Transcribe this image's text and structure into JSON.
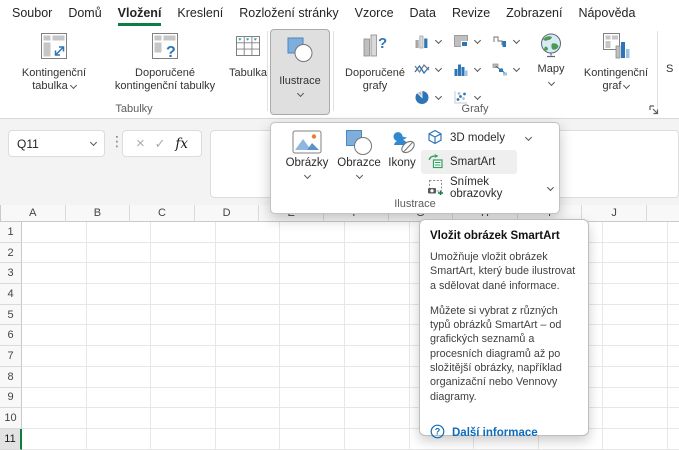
{
  "menu": {
    "tabs": [
      {
        "label": "Soubor"
      },
      {
        "label": "Domů"
      },
      {
        "label": "Vložení"
      },
      {
        "label": "Kreslení"
      },
      {
        "label": "Rozložení stránky"
      },
      {
        "label": "Vzorce"
      },
      {
        "label": "Data"
      },
      {
        "label": "Revize"
      },
      {
        "label": "Zobrazení"
      },
      {
        "label": "Nápověda"
      }
    ],
    "active_tab": "Vložení"
  },
  "ribbon": {
    "pivot_table": {
      "line1": "Kontingenční",
      "line2": "tabulka"
    },
    "recommended_pivots": {
      "line1": "Doporučené",
      "line2": "kontingenční tabulky"
    },
    "table": {
      "label": "Tabulka"
    },
    "illustrations": {
      "label": "Ilustrace"
    },
    "recommended_charts": {
      "line1": "Doporučené",
      "line2": "grafy"
    },
    "maps": {
      "label": "Mapy"
    },
    "pivot_chart": {
      "line1": "Kontingenční",
      "line2": "graf"
    },
    "group_tables": "Tabulky",
    "group_charts": "Grafy",
    "cutoff_right": "S"
  },
  "formula_bar": {
    "name_box_value": "Q11"
  },
  "icons": {
    "cancel": "×",
    "enter": "✓",
    "fx": "fx",
    "dots": "⋮"
  },
  "dropdown": {
    "items_large": [
      {
        "label": "Obrázky",
        "has_chevron": true
      },
      {
        "label": "Obrazce",
        "has_chevron": true
      },
      {
        "label": "Ikony",
        "has_chevron": false
      }
    ],
    "items_menu": [
      {
        "label": "3D modely",
        "has_chevron": true
      },
      {
        "label": "SmartArt",
        "has_chevron": false,
        "hovered": true
      },
      {
        "label": "Snímek obrazovky",
        "has_chevron": true
      }
    ],
    "footer": "Ilustrace"
  },
  "tooltip": {
    "title": "Vložit obrázek SmartArt",
    "body1": "Umožňuje vložit obrázek SmartArt, který bude ilustrovat a sdělovat dané informace.",
    "body2": "Můžete si vybrat z různých typů obrázků SmartArt – od grafických seznamů a procesních diagramů až po složitější obrázky, například organizační nebo Vennovy diagramy.",
    "link": "Další informace"
  },
  "grid": {
    "columns": [
      "A",
      "B",
      "C",
      "D",
      "E",
      "F",
      "G",
      "H",
      "I",
      "J"
    ],
    "rows": [
      "1",
      "2",
      "3",
      "4",
      "5",
      "6",
      "7",
      "8",
      "9",
      "10",
      "11"
    ],
    "active_row": "11"
  },
  "colors": {
    "accent_green": "#107C41",
    "link_blue": "#0F6CBD",
    "icon_blue": "#2E75B6",
    "icon_light_blue": "#9DC3E6",
    "sun_orange": "#ED7D31",
    "filter_teal": "#2E9BA6",
    "smartart_green": "#2EA15D"
  }
}
